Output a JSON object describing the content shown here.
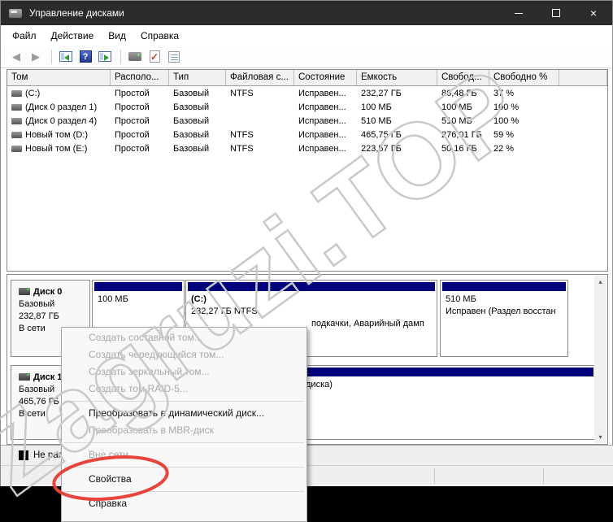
{
  "colors": {
    "titlebar": "#2b2b2b",
    "partition_primary": "#00007c",
    "annotation_red": "#e8433c",
    "watermark_gray": "#c9c9c9"
  },
  "window": {
    "title": "Управление дисками"
  },
  "icons": {
    "close_glyph": "×",
    "back_glyph": "◀",
    "forward_glyph": "▶",
    "help_glyph": "?",
    "check_glyph": "✓",
    "scroll_up_glyph": "▴",
    "scroll_down_glyph": "▾"
  },
  "menubar": {
    "items": [
      {
        "label": "Файл"
      },
      {
        "label": "Действие"
      },
      {
        "label": "Вид"
      },
      {
        "label": "Справка"
      }
    ]
  },
  "volumes_table": {
    "columns": [
      "Том",
      "Располо...",
      "Тип",
      "Файловая с...",
      "Состояние",
      "Емкость",
      "Свобод...",
      "Свободно %"
    ],
    "rows": [
      {
        "volume": "(C:)",
        "layout": "Простой",
        "type": "Базовый",
        "fs": "NTFS",
        "status": "Исправен...",
        "capacity": "232,27 ГБ",
        "free": "86,48 ГБ",
        "free_pct": "37 %"
      },
      {
        "volume": "(Диск 0 раздел 1)",
        "layout": "Простой",
        "type": "Базовый",
        "fs": "",
        "status": "Исправен...",
        "capacity": "100 МБ",
        "free": "100 МБ",
        "free_pct": "100 %"
      },
      {
        "volume": "(Диск 0 раздел 4)",
        "layout": "Простой",
        "type": "Базовый",
        "fs": "",
        "status": "Исправен...",
        "capacity": "510 МБ",
        "free": "510 МБ",
        "free_pct": "100 %"
      },
      {
        "volume": "Новый том (D:)",
        "layout": "Простой",
        "type": "Базовый",
        "fs": "NTFS",
        "status": "Исправен...",
        "capacity": "465,75 ГБ",
        "free": "276,01 ГБ",
        "free_pct": "59 %"
      },
      {
        "volume": "Новый том (E:)",
        "layout": "Простой",
        "type": "Базовый",
        "fs": "NTFS",
        "status": "Исправен...",
        "capacity": "223,57 ГБ",
        "free": "50,16 ГБ",
        "free_pct": "22 %"
      }
    ]
  },
  "disks": [
    {
      "name": "Диск 0",
      "type": "Базовый",
      "size": "232,87 ГБ",
      "status": "В сети",
      "partitions": [
        {
          "label": "",
          "size": "100 МБ",
          "status_fragment": ""
        },
        {
          "label": "(C:)",
          "size": "232,27 ГБ NTFS",
          "status_fragment": "подкачки, Аварийный дамп"
        },
        {
          "label": "",
          "size": "510 МБ",
          "status_fragment": "Исправен (Раздел восстан"
        }
      ]
    },
    {
      "name": "Диск 1",
      "type": "Базовый",
      "size": "465,76 ГБ",
      "status": "В сети",
      "partitions": [
        {
          "label": "",
          "size": "",
          "status_fragment": "диска)"
        }
      ]
    }
  ],
  "legend": {
    "unallocated": "Не распределен"
  },
  "context_menu": {
    "items": [
      {
        "label": "Создать составной том...",
        "enabled": false
      },
      {
        "label": "Создать чередующийся том...",
        "enabled": false
      },
      {
        "label": "Создать зеркальный том...",
        "enabled": false
      },
      {
        "label": "Создать том RAID-5...",
        "enabled": false
      },
      {
        "label": "Преобразовать в динамический диск...",
        "enabled": true
      },
      {
        "label": "Преобразовать в MBR-диск",
        "enabled": false
      },
      {
        "label": "Вне сети",
        "enabled": false
      },
      {
        "label": "Свойства",
        "enabled": true
      },
      {
        "label": "Справка",
        "enabled": true
      }
    ]
  },
  "watermark": {
    "text": "Zagruzi.TOP"
  }
}
